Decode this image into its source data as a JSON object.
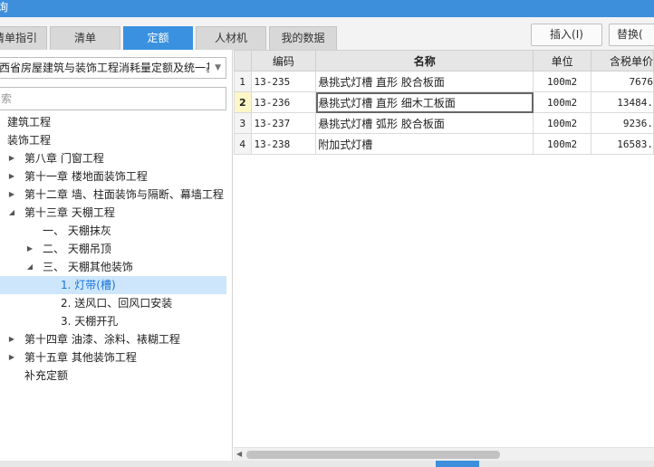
{
  "window": {
    "title": "询"
  },
  "tabs": [
    {
      "label": "清单指引",
      "active": false
    },
    {
      "label": "清单",
      "active": false
    },
    {
      "label": "定额",
      "active": true
    },
    {
      "label": "人材机",
      "active": false
    },
    {
      "label": "我的数据",
      "active": false
    }
  ],
  "buttons": {
    "insert": "插入(I)",
    "replace": "替换("
  },
  "left": {
    "dropdown_value": "西省房屋建筑与装饰工程消耗量定额及统一基",
    "search_placeholder": "索",
    "tree": [
      {
        "label": "建筑工程",
        "arrow": ""
      },
      {
        "label": "装饰工程",
        "arrow": ""
      },
      {
        "label": "第八章 门窗工程",
        "arrow": "▶"
      },
      {
        "label": "第十一章 楼地面装饰工程",
        "arrow": "▶"
      },
      {
        "label": "第十二章 墙、柱面装饰与隔断、幕墙工程",
        "arrow": "▶"
      },
      {
        "label": "第十三章 天棚工程",
        "arrow": "◢"
      },
      {
        "label": "一、 天棚抹灰",
        "arrow": ""
      },
      {
        "label": "二、 天棚吊顶",
        "arrow": "▶"
      },
      {
        "label": "三、 天棚其他装饰",
        "arrow": "◢"
      },
      {
        "label": "1. 灯带(槽)",
        "arrow": ""
      },
      {
        "label": "2. 送风口、回风口安装",
        "arrow": ""
      },
      {
        "label": "3. 天棚开孔",
        "arrow": ""
      },
      {
        "label": "第十四章 油漆、涂料、裱糊工程",
        "arrow": "▶"
      },
      {
        "label": "第十五章 其他装饰工程",
        "arrow": "▶"
      },
      {
        "label": "补充定额",
        "arrow": ""
      }
    ]
  },
  "table": {
    "headers": {
      "code": "编码",
      "name": "名称",
      "unit": "单位",
      "price": "含税单价"
    },
    "rows": [
      {
        "num": "1",
        "code": "13-235",
        "name": "悬挑式灯槽 直形 胶合板面",
        "unit": "100m2",
        "price": "7676"
      },
      {
        "num": "2",
        "code": "13-236",
        "name": "悬挑式灯槽 直形 细木工板面",
        "unit": "100m2",
        "price": "13484."
      },
      {
        "num": "3",
        "code": "13-237",
        "name": "悬挑式灯槽 弧形 胶合板面",
        "unit": "100m2",
        "price": "9236."
      },
      {
        "num": "4",
        "code": "13-238",
        "name": "附加式灯槽",
        "unit": "100m2",
        "price": "16583."
      }
    ]
  },
  "icons": {
    "dropdown": "chevron-down-icon",
    "scroll_left": "arrow-left-icon"
  }
}
